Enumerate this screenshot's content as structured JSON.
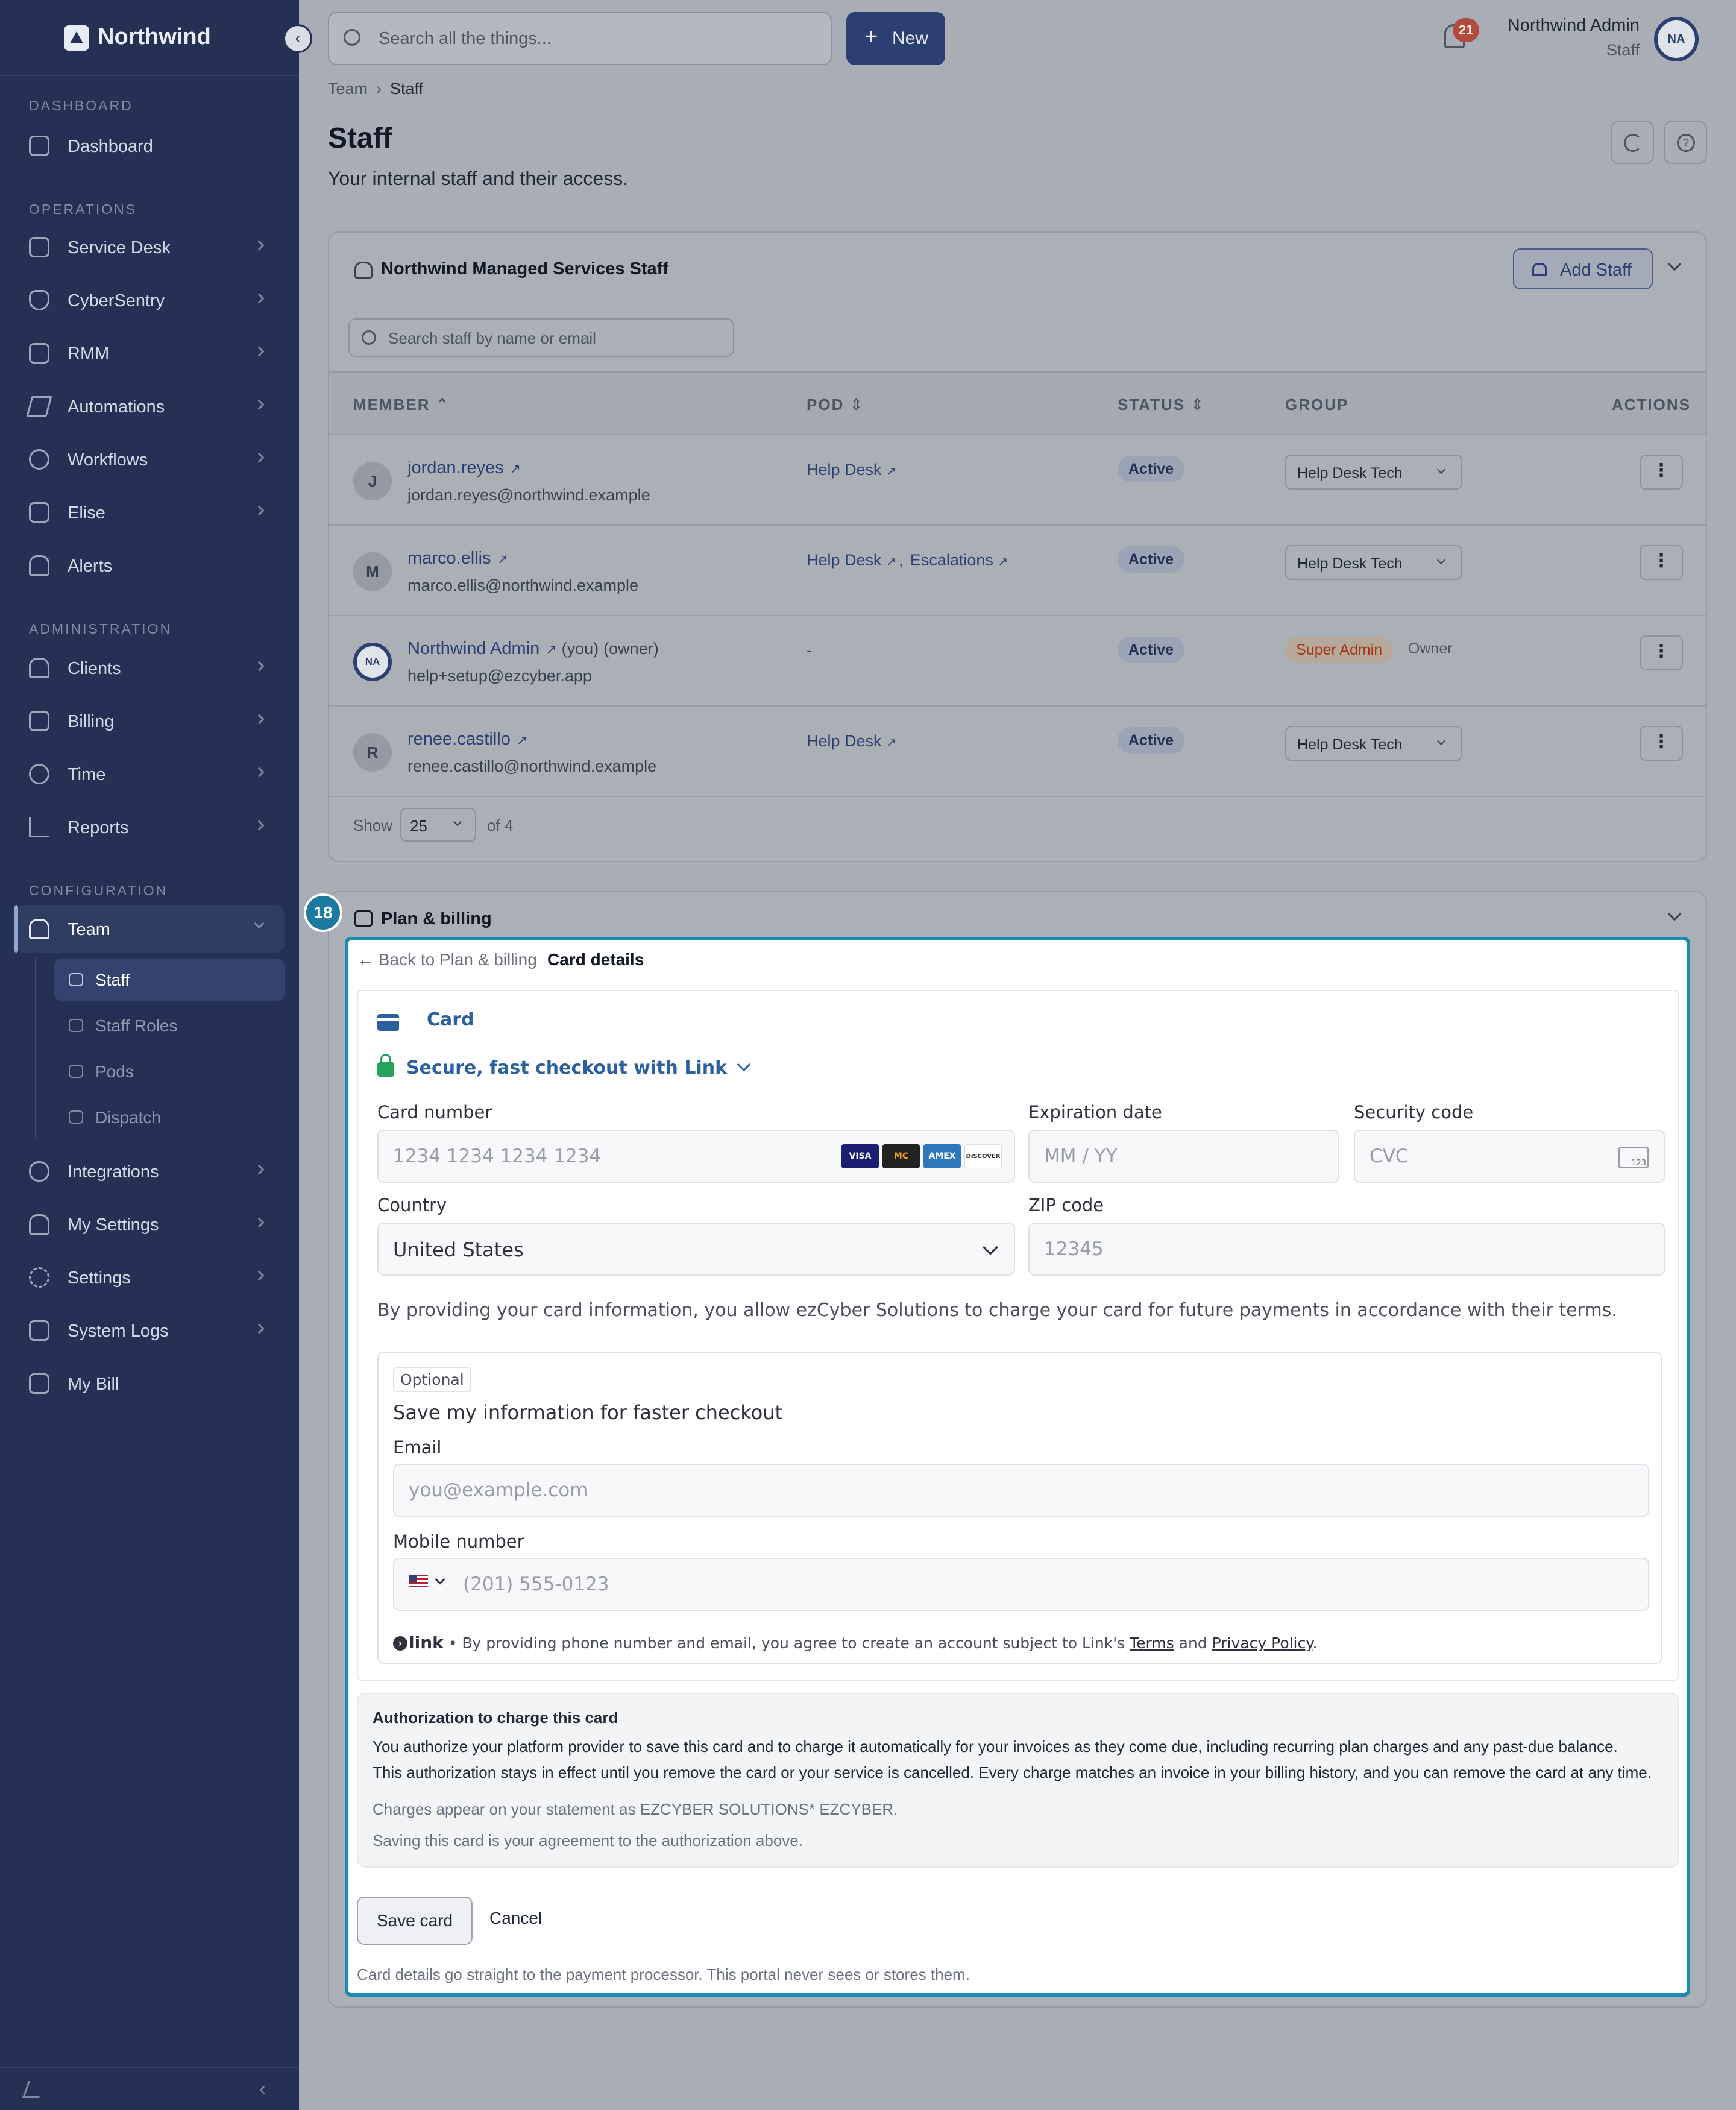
{
  "app": {
    "brand": "Northwind"
  },
  "sidebar": {
    "sections": {
      "dashboard": "DASHBOARD",
      "operations": "OPERATIONS",
      "administration": "ADMINISTRATION",
      "configuration": "CONFIGURATION"
    },
    "items": {
      "dashboard": "Dashboard",
      "service_desk": "Service Desk",
      "cybersentry": "CyberSentry",
      "rmm": "RMM",
      "automations": "Automations",
      "workflows": "Workflows",
      "elise": "Elise",
      "alerts": "Alerts",
      "clients": "Clients",
      "billing": "Billing",
      "time": "Time",
      "reports": "Reports",
      "team": "Team",
      "integrations": "Integrations",
      "my_settings": "My Settings",
      "settings": "Settings",
      "system_logs": "System Logs",
      "my_bill": "My Bill"
    },
    "team_sub": {
      "staff": "Staff",
      "staff_roles": "Staff Roles",
      "pods": "Pods",
      "dispatch": "Dispatch"
    }
  },
  "topbar": {
    "search_placeholder": "Search all the things...",
    "new_label": "New",
    "notif_count": "21",
    "user_name": "Northwind Admin",
    "user_role": "Staff",
    "user_initials": "NA"
  },
  "page": {
    "breadcrumb": [
      "Team",
      "Staff"
    ],
    "title": "Staff",
    "subtitle": "Your internal staff and their access."
  },
  "staff_card": {
    "title": "Northwind Managed Services Staff",
    "add_label": "Add Staff",
    "search_placeholder": "Search staff by name or email",
    "columns": {
      "member": "MEMBER",
      "pod": "POD",
      "status": "STATUS",
      "group": "GROUP",
      "actions": "ACTIONS"
    },
    "rows": [
      {
        "initial": "J",
        "name": "jordan.reyes",
        "email": "jordan.reyes@northwind.example",
        "pod": "Help Desk",
        "status": "Active",
        "group": "Help Desk Tech"
      },
      {
        "initial": "M",
        "name": "marco.ellis",
        "email": "marco.ellis@northwind.example",
        "pod": "Help Desk",
        "pod2": "Escalations",
        "status": "Active",
        "group": "Help Desk Tech"
      },
      {
        "initial": "NA",
        "name": "Northwind Admin",
        "you": "(you)",
        "owner_tag": "(owner)",
        "email": "help+setup@ezcyber.app",
        "pod": "-",
        "status": "Active",
        "group_badge": "Super Admin",
        "group_note": "Owner"
      },
      {
        "initial": "R",
        "name": "renee.castillo",
        "email": "renee.castillo@northwind.example",
        "pod": "Help Desk",
        "status": "Active",
        "group": "Help Desk Tech"
      }
    ],
    "pager": {
      "show": "Show",
      "per_page": "25",
      "of": "of 4"
    }
  },
  "billing_card": {
    "title": "Plan & billing",
    "step": "18",
    "back_label": "Back to Plan & billing",
    "current": "Card details",
    "stripe": {
      "tab": "Card",
      "link_head": "Secure, fast checkout with Link",
      "card_number_label": "Card number",
      "card_number_ph": "1234 1234 1234 1234",
      "expiry_label": "Expiration date",
      "expiry_ph": "MM / YY",
      "cvc_label": "Security code",
      "cvc_ph": "CVC",
      "country_label": "Country",
      "country_value": "United States",
      "zip_label": "ZIP code",
      "zip_ph": "12345",
      "card_brands": [
        "VISA",
        "MC",
        "AMEX",
        "DISCOVER"
      ],
      "consent": "By providing your card information, you allow ezCyber Solutions to charge your card for future payments in accordance with their terms.",
      "optional_tag": "Optional",
      "save_info": "Save my information for faster checkout",
      "email_label": "Email",
      "email_ph": "you@example.com",
      "mobile_label": "Mobile number",
      "mobile_ph": "(201) 555-0123",
      "link_logo": "link",
      "link_note": "• By providing phone number and email, you agree to create an account subject to Link's",
      "terms": "Terms",
      "and": "and",
      "privacy": "Privacy Policy"
    },
    "auth": {
      "title": "Authorization to charge this card",
      "p1": "You authorize your platform provider to save this card and to charge it automatically for your invoices as they come due, including recurring plan charges and any past-due balance.",
      "p2": "This authorization stays in effect until you remove the card or your service is cancelled. Every charge matches an invoice in your billing history, and you can remove the card at any time.",
      "statement": "Charges appear on your statement as EZCYBER SOLUTIONS* EZCYBER.",
      "agreement": "Saving this card is your agreement to the authorization above."
    },
    "save_label": "Save card",
    "cancel_label": "Cancel",
    "foot_note": "Card details go straight to the payment processor. This portal never sees or stores them."
  },
  "colors": {
    "sidebar": "#243154",
    "accent": "#2b3f73",
    "highlight": "#1b8bb1",
    "link_green": "#26a35a"
  }
}
